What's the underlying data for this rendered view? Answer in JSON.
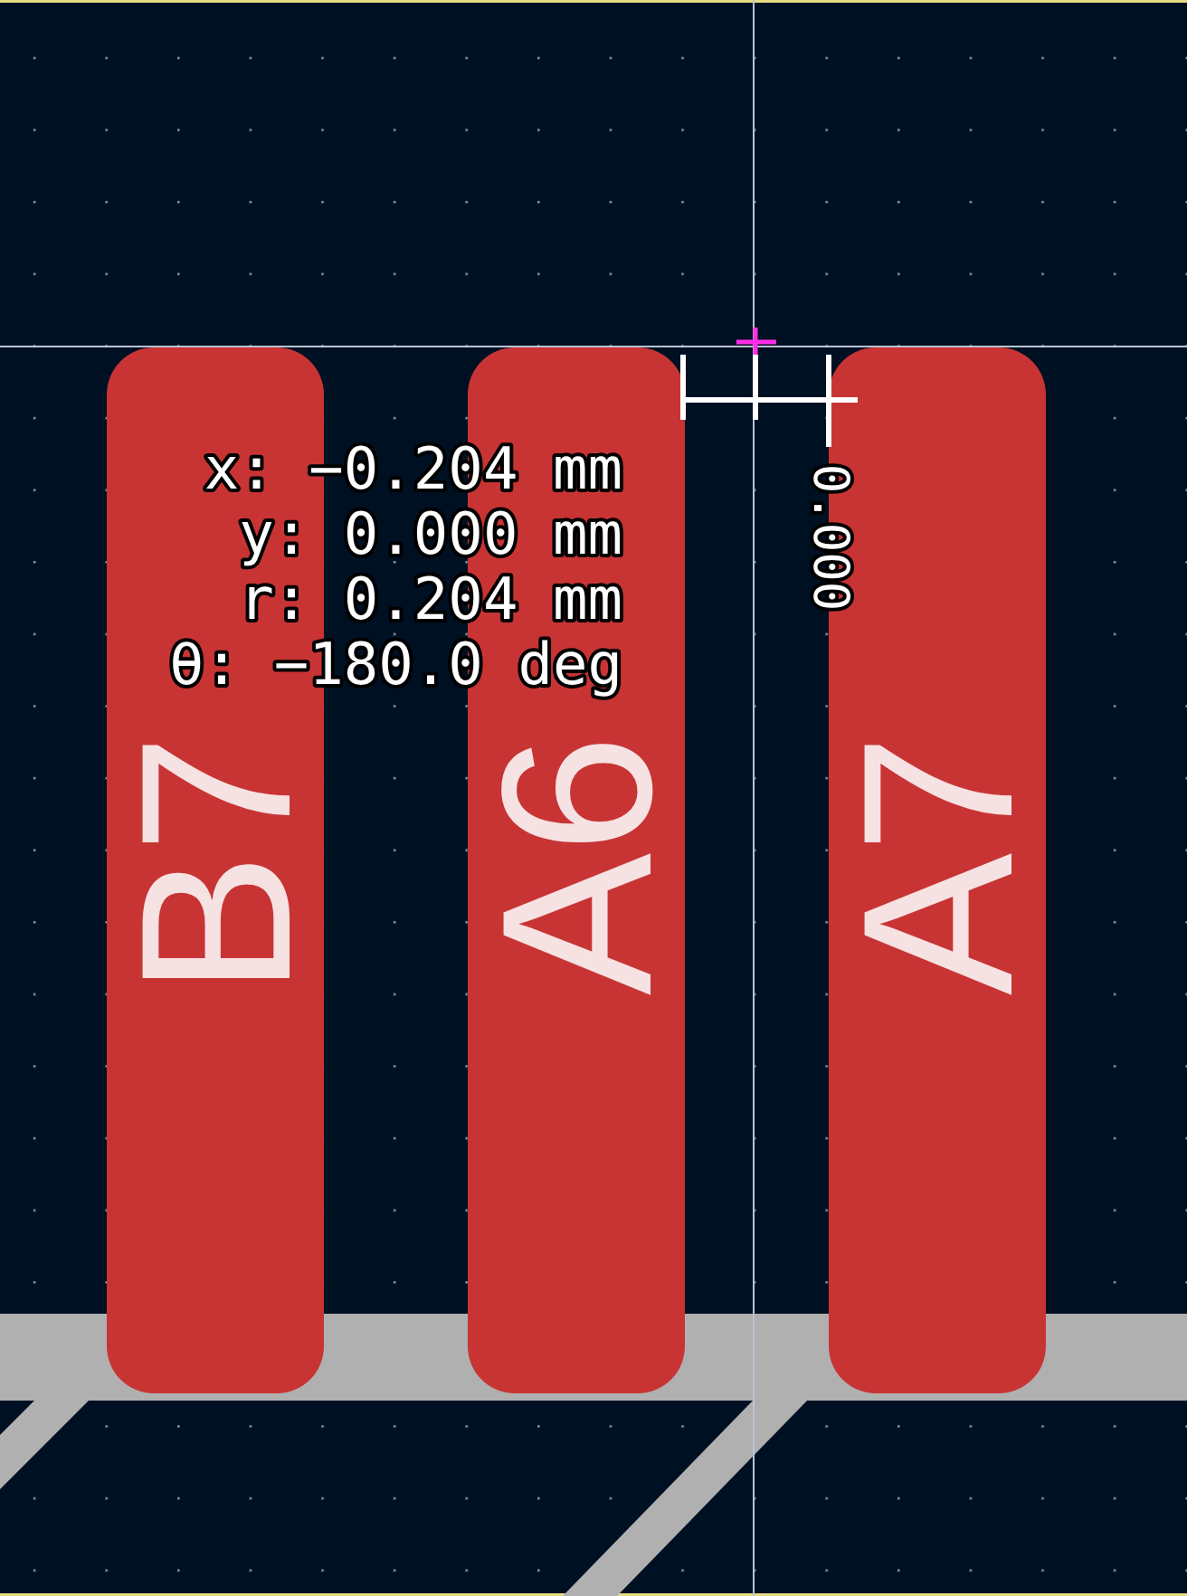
{
  "canvas": {
    "pads": [
      {
        "label": "B7"
      },
      {
        "label": "A6"
      },
      {
        "label": "A7"
      }
    ],
    "measurement": {
      "readout": [
        "x: −0.204 mm",
        "y: 0.000 mm",
        "r: 0.204 mm",
        "θ: −180.0 deg"
      ],
      "ruler_value": "0.000"
    }
  }
}
